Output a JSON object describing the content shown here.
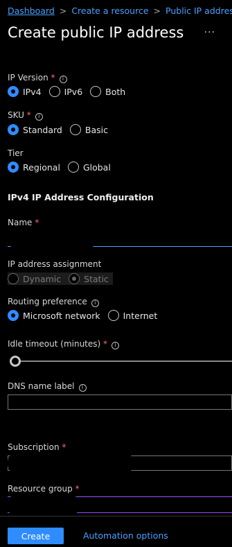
{
  "breadcrumb": [
    "Dashboard",
    "Create a resource",
    "Public IP address"
  ],
  "page": {
    "title": "Create public IP address",
    "more": "···"
  },
  "ip_version": {
    "label": "IP Version",
    "required": "*",
    "options": [
      "IPv4",
      "IPv6",
      "Both"
    ],
    "selected": "IPv4"
  },
  "sku": {
    "label": "SKU",
    "required": "*",
    "options": [
      "Standard",
      "Basic"
    ],
    "selected": "Standard"
  },
  "tier": {
    "label": "Tier",
    "options": [
      "Regional",
      "Global"
    ],
    "selected": "Regional"
  },
  "section": {
    "title": "IPv4 IP Address Configuration"
  },
  "name": {
    "label": "Name",
    "required": "*",
    "value": ""
  },
  "assignment": {
    "label": "IP address assignment",
    "options": [
      "Dynamic",
      "Static"
    ],
    "selected": "Static",
    "disabled": true
  },
  "routing": {
    "label": "Routing preference",
    "options": [
      "Microsoft network",
      "Internet"
    ],
    "selected": "Microsoft network"
  },
  "idle": {
    "label": "Idle timeout (minutes)",
    "required": "*",
    "value_fraction": 0
  },
  "dns": {
    "label": "DNS name label",
    "value": ""
  },
  "subscription": {
    "label": "Subscription",
    "required": "*"
  },
  "resource_group": {
    "label": "Resource group",
    "required": "*"
  },
  "footer": {
    "create": "Create",
    "automation": "Automation options"
  },
  "icons": {
    "info": "info-icon",
    "more": "more-icon"
  },
  "colors": {
    "accent": "#2f8cff",
    "link": "#4aa0ff",
    "required": "#ff6b6b"
  }
}
